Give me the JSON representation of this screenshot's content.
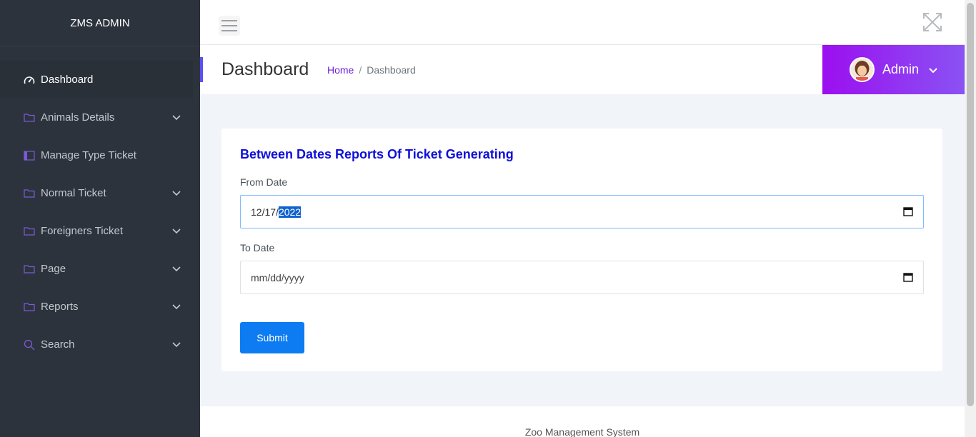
{
  "brand": "ZMS ADMIN",
  "sidebar": {
    "items": [
      {
        "label": "Dashboard",
        "icon": "dashboard-icon",
        "active": true,
        "expandable": false
      },
      {
        "label": "Animals Details",
        "icon": "folder-icon",
        "expandable": true
      },
      {
        "label": "Manage Type Ticket",
        "icon": "book-icon",
        "expandable": false
      },
      {
        "label": "Normal Ticket",
        "icon": "folder-icon",
        "expandable": true
      },
      {
        "label": "Foreigners Ticket",
        "icon": "folder-icon",
        "expandable": true
      },
      {
        "label": "Page",
        "icon": "folder-icon",
        "expandable": true
      },
      {
        "label": "Reports",
        "icon": "folder-icon",
        "expandable": true
      },
      {
        "label": "Search",
        "icon": "search-icon",
        "expandable": true
      }
    ]
  },
  "header": {
    "page_title": "Dashboard",
    "breadcrumb": {
      "home": "Home",
      "separator": "/",
      "current": "Dashboard"
    },
    "user_name": "Admin"
  },
  "form": {
    "title": "Between Dates Reports Of Ticket Generating",
    "from_label": "From Date",
    "from_value_prefix": "12/17/",
    "from_value_selected": "2022",
    "to_label": "To Date",
    "to_placeholder": "mm/dd/yyyy",
    "submit_label": "Submit"
  },
  "footer": {
    "text": "Zoo Management System"
  },
  "colors": {
    "sidebar_bg": "#2d333d",
    "accent_purple": "#9b0ff0",
    "title_blue": "#0f0fd8",
    "submit_blue": "#0d7cf2",
    "breadcrumb_link": "#6f1fd8"
  }
}
